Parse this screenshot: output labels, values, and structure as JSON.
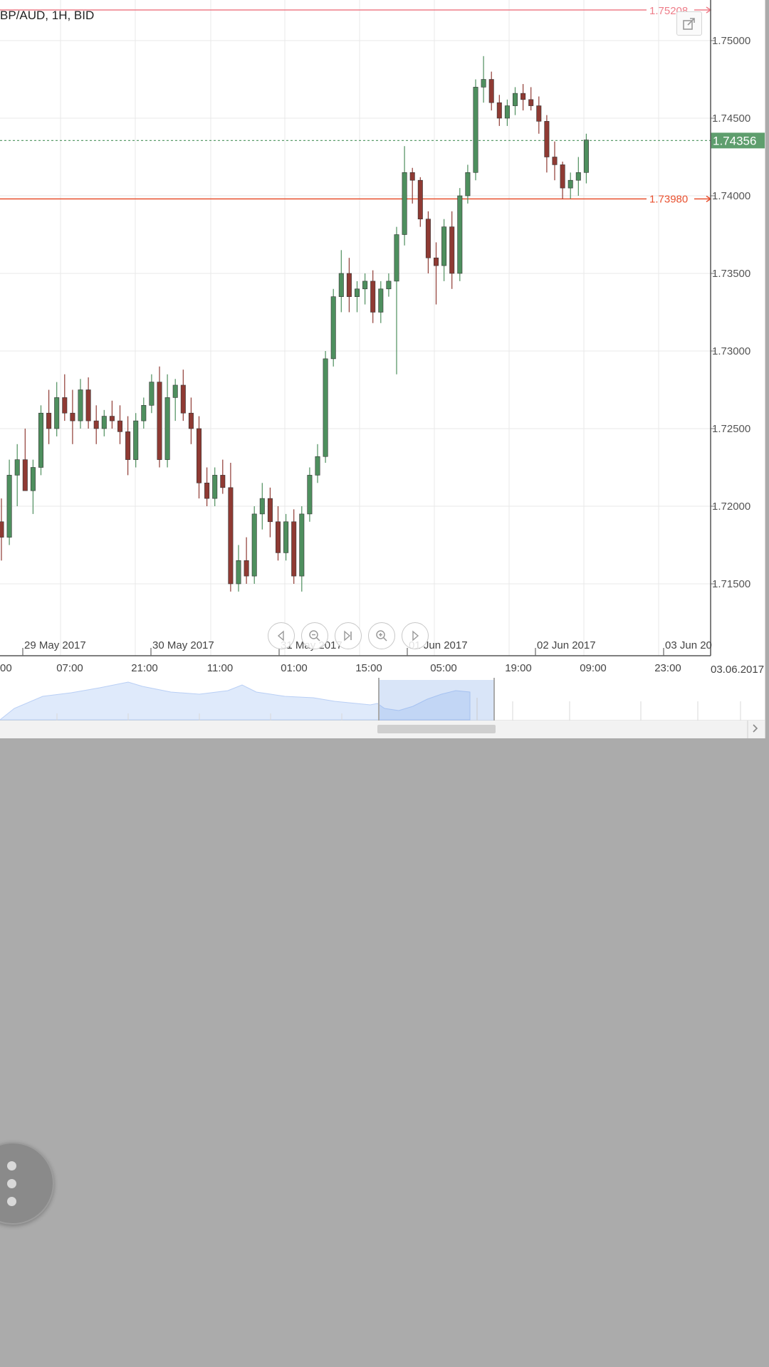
{
  "chart": {
    "title": "BP/AUD, 1H, BID",
    "current_price": "1.74356",
    "levels": {
      "top": "1.75208",
      "support": "1.73980"
    },
    "price_ticks": [
      "1.75000",
      "1.74500",
      "1.74000",
      "1.73500",
      "1.73000",
      "1.72500",
      "1.72000",
      "1.71500"
    ],
    "date_labels": [
      "29 May 2017",
      "30 May 2017",
      "31 May 2017",
      "01 Jun 2017",
      "02 Jun 2017",
      "03 Jun 20"
    ],
    "time_labels": [
      "00",
      "07:00",
      "21:00",
      "11:00",
      "01:00",
      "15:00",
      "05:00",
      "19:00",
      "09:00",
      "23:00"
    ],
    "navigator_date": "03.06.2017",
    "colors": {
      "up": "#4e8f5e",
      "down": "#8f3a33",
      "support_line": "#e8502f",
      "top_line": "#ee7d89",
      "current_bg": "#5e9e6d"
    }
  },
  "chart_data": {
    "type": "candlestick",
    "title": "BP/AUD, 1H, BID",
    "ylim": [
      1.713,
      1.753
    ],
    "x": [
      "29 May 2017",
      "30 May 2017",
      "31 May 2017",
      "01 Jun 2017",
      "02 Jun 2017",
      "03 Jun 20"
    ],
    "current_price": 1.74356,
    "lines": [
      1.75208,
      1.7398
    ],
    "series": [
      {
        "values": [
          [
            1.719,
            1.7205,
            1.7165,
            1.718
          ],
          [
            1.718,
            1.723,
            1.7175,
            1.722
          ],
          [
            1.722,
            1.724,
            1.72,
            1.723
          ],
          [
            1.723,
            1.725,
            1.7215,
            1.721
          ],
          [
            1.721,
            1.723,
            1.7195,
            1.7225
          ],
          [
            1.7225,
            1.7265,
            1.722,
            1.726
          ],
          [
            1.726,
            1.7275,
            1.724,
            1.725
          ],
          [
            1.725,
            1.728,
            1.7245,
            1.727
          ],
          [
            1.727,
            1.7285,
            1.7255,
            1.726
          ],
          [
            1.726,
            1.7275,
            1.724,
            1.7255
          ],
          [
            1.7255,
            1.7282,
            1.725,
            1.7275
          ],
          [
            1.7275,
            1.7283,
            1.725,
            1.7255
          ],
          [
            1.7255,
            1.7265,
            1.724,
            1.725
          ],
          [
            1.725,
            1.7262,
            1.7245,
            1.7258
          ],
          [
            1.7258,
            1.7268,
            1.725,
            1.7255
          ],
          [
            1.7255,
            1.7265,
            1.724,
            1.7248
          ],
          [
            1.7248,
            1.7258,
            1.722,
            1.723
          ],
          [
            1.723,
            1.726,
            1.7225,
            1.7255
          ],
          [
            1.7255,
            1.727,
            1.725,
            1.7265
          ],
          [
            1.7265,
            1.7285,
            1.726,
            1.728
          ],
          [
            1.728,
            1.729,
            1.7225,
            1.723
          ],
          [
            1.723,
            1.7285,
            1.7225,
            1.727
          ],
          [
            1.727,
            1.7282,
            1.7255,
            1.7278
          ],
          [
            1.7278,
            1.7288,
            1.7255,
            1.726
          ],
          [
            1.726,
            1.727,
            1.724,
            1.725
          ],
          [
            1.725,
            1.7258,
            1.7205,
            1.7215
          ],
          [
            1.7215,
            1.7225,
            1.72,
            1.7205
          ],
          [
            1.7205,
            1.7225,
            1.72,
            1.722
          ],
          [
            1.722,
            1.723,
            1.7208,
            1.7212
          ],
          [
            1.7212,
            1.7228,
            1.7145,
            1.715
          ],
          [
            1.715,
            1.7175,
            1.7145,
            1.7165
          ],
          [
            1.7165,
            1.718,
            1.715,
            1.7155
          ],
          [
            1.7155,
            1.72,
            1.715,
            1.7195
          ],
          [
            1.7195,
            1.7215,
            1.7185,
            1.7205
          ],
          [
            1.7205,
            1.7212,
            1.718,
            1.719
          ],
          [
            1.719,
            1.72,
            1.7165,
            1.717
          ],
          [
            1.717,
            1.7195,
            1.7165,
            1.719
          ],
          [
            1.719,
            1.7198,
            1.715,
            1.7155
          ],
          [
            1.7155,
            1.72,
            1.7145,
            1.7195
          ],
          [
            1.7195,
            1.7225,
            1.719,
            1.722
          ],
          [
            1.722,
            1.724,
            1.7215,
            1.7232
          ],
          [
            1.7232,
            1.73,
            1.7228,
            1.7295
          ],
          [
            1.7295,
            1.734,
            1.729,
            1.7335
          ],
          [
            1.7335,
            1.7365,
            1.7325,
            1.735
          ],
          [
            1.735,
            1.736,
            1.7325,
            1.7335
          ],
          [
            1.7335,
            1.7345,
            1.7325,
            1.734
          ],
          [
            1.734,
            1.735,
            1.733,
            1.7345
          ],
          [
            1.7345,
            1.7352,
            1.7318,
            1.7325
          ],
          [
            1.7325,
            1.7345,
            1.7318,
            1.734
          ],
          [
            1.734,
            1.735,
            1.7335,
            1.7345
          ],
          [
            1.7345,
            1.738,
            1.7285,
            1.7375
          ],
          [
            1.7375,
            1.7432,
            1.7368,
            1.7415
          ],
          [
            1.7415,
            1.7418,
            1.7395,
            1.741
          ],
          [
            1.741,
            1.7412,
            1.738,
            1.7385
          ],
          [
            1.7385,
            1.739,
            1.735,
            1.736
          ],
          [
            1.736,
            1.737,
            1.733,
            1.7355
          ],
          [
            1.7355,
            1.7385,
            1.7345,
            1.738
          ],
          [
            1.738,
            1.739,
            1.734,
            1.735
          ],
          [
            1.735,
            1.7405,
            1.7345,
            1.74
          ],
          [
            1.74,
            1.742,
            1.7395,
            1.7415
          ],
          [
            1.7415,
            1.7475,
            1.741,
            1.747
          ],
          [
            1.747,
            1.749,
            1.746,
            1.7475
          ],
          [
            1.7475,
            1.748,
            1.7455,
            1.746
          ],
          [
            1.746,
            1.7465,
            1.7445,
            1.745
          ],
          [
            1.745,
            1.7462,
            1.7445,
            1.7458
          ],
          [
            1.7458,
            1.747,
            1.7452,
            1.7466
          ],
          [
            1.7466,
            1.7472,
            1.7455,
            1.7462
          ],
          [
            1.7462,
            1.747,
            1.7455,
            1.7458
          ],
          [
            1.7458,
            1.7464,
            1.744,
            1.7448
          ],
          [
            1.7448,
            1.7452,
            1.7415,
            1.7425
          ],
          [
            1.7425,
            1.7435,
            1.741,
            1.742
          ],
          [
            1.742,
            1.7422,
            1.7398,
            1.7405
          ],
          [
            1.7405,
            1.7415,
            1.7398,
            1.741
          ],
          [
            1.741,
            1.7425,
            1.74,
            1.7415
          ],
          [
            1.7415,
            1.744,
            1.7408,
            1.7436
          ]
        ]
      }
    ]
  }
}
